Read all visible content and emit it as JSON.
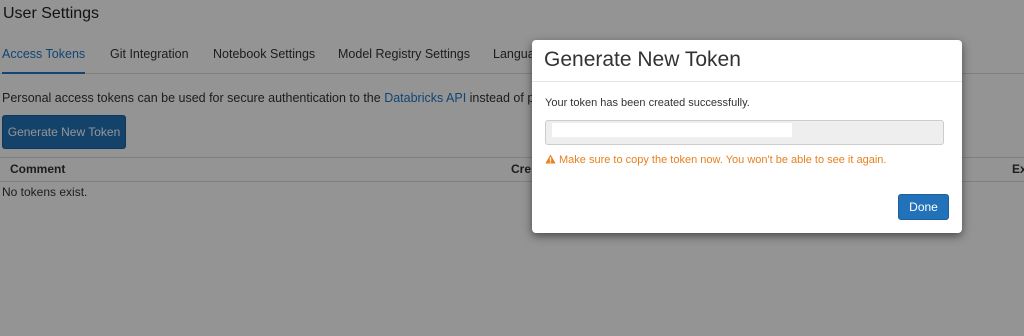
{
  "page": {
    "title": "User Settings"
  },
  "tabs": [
    {
      "label": "Access Tokens",
      "active": true
    },
    {
      "label": "Git Integration",
      "active": false
    },
    {
      "label": "Notebook Settings",
      "active": false
    },
    {
      "label": "Model Registry Settings",
      "active": false
    },
    {
      "label": "Langua",
      "active": false
    }
  ],
  "access_tokens": {
    "description_prefix": "Personal access tokens can be used for secure authentication to the ",
    "description_link": "Databricks API",
    "description_suffix": " instead of pass",
    "generate_button_label": "Generate New Token",
    "table": {
      "columns": [
        "Comment",
        "Cre",
        "Ex"
      ]
    },
    "empty_message": "No tokens exist."
  },
  "modal": {
    "title": "Generate New Token",
    "message": "Your token has been created successfully.",
    "token_value": "",
    "warning": "Make sure to copy the token now. You won't be able to see it again.",
    "warning_icon": "warning-triangle-icon",
    "done_label": "Done"
  },
  "colors": {
    "accent": "#2272b9",
    "link": "#1f77c7",
    "warning": "#e8801e",
    "overlay": "rgba(0,0,0,0.42)"
  }
}
